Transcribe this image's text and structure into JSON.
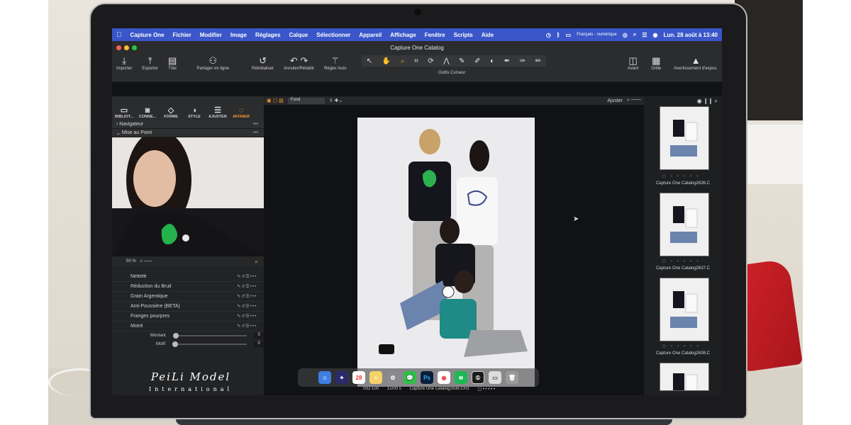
{
  "menubar": {
    "items": [
      "Capture One",
      "Fichier",
      "Modifier",
      "Image",
      "Réglages",
      "Calque",
      "Sélectionner",
      "Appareil",
      "Affichage",
      "Fenêtre",
      "Scripts",
      "Aide"
    ],
    "input_source": "Français - numérique",
    "clock": "Lun. 28 août à 13:40"
  },
  "window": {
    "title": "Capture One Catalog"
  },
  "toolbar": {
    "importer": "Importer",
    "exporter": "Exporter",
    "trier": "Trier",
    "partager": "Partager en ligne",
    "reinitialiser": "Réinitialiser",
    "annuler": "Annuler/Rétablir",
    "regler_auto": "Régler Auto",
    "outils_curseur": "Outils Curseur",
    "avant": "Avant",
    "grille": "Grille",
    "avertissement": "Avertissement d'expos."
  },
  "tool_tabs": [
    "BIBLIOT...",
    "CONNE...",
    "FORME",
    "STYLE",
    "AJUSTER",
    "AFFINER"
  ],
  "sections": {
    "navigateur": "Navigateur",
    "mise_au_point": "Mise au Point"
  },
  "focus": {
    "zoom": "50 %"
  },
  "tools": [
    "Netteté",
    "Réduction du Bruit",
    "Grain Argentique",
    "Anti-Poussière (BETA)",
    "Franges pourpres",
    "Moiré"
  ],
  "moire": {
    "montant_label": "Montant",
    "montant_value": "0",
    "motif_label": "Motif",
    "motif_value": "0"
  },
  "viewer": {
    "background_select": "Fond",
    "adjust_label": "Ajuster",
    "iso": "ISO 100",
    "shutter": "1/200 s",
    "filename": "Capture One Catalog2636.CR3"
  },
  "filmstrip": [
    {
      "label": "Capture One Catalog2636.C"
    },
    {
      "label": "Capture One Catalog2637.C"
    },
    {
      "label": "Capture One Catalog2638.C"
    }
  ],
  "watermark": {
    "main": "PeiLi Model",
    "sub": "International"
  },
  "colors": {
    "menubar": "#3a56c8",
    "accent": "#f19a2f",
    "panel": "#222325"
  }
}
